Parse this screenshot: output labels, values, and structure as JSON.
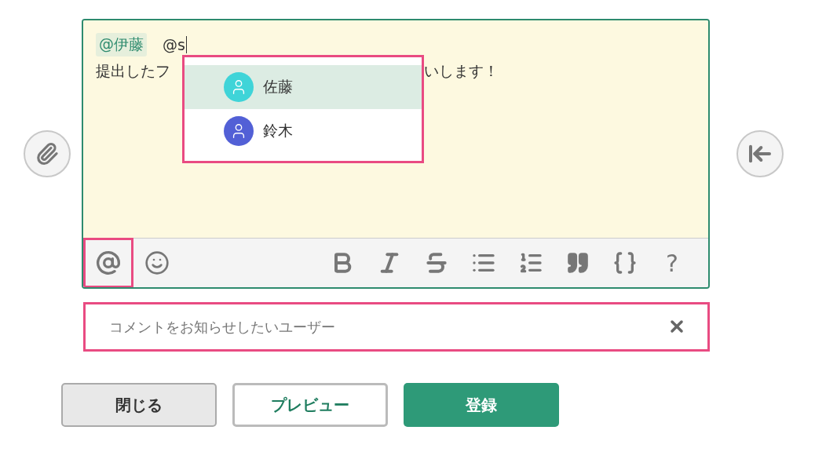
{
  "editor": {
    "mention": "@伊藤",
    "typed": "@s",
    "line_start": "提出したフ",
    "line_end": "いします！"
  },
  "suggestions": [
    {
      "name": "佐藤",
      "selected": true,
      "color": "#3fd4d8"
    },
    {
      "name": "鈴木",
      "selected": false,
      "color": "#5260d6"
    }
  ],
  "toolbar": {
    "help": "?"
  },
  "notify_field": {
    "placeholder": "コメントをお知らせしたいユーザー"
  },
  "buttons": [
    {
      "label": "閉じる",
      "kind": "secondary"
    },
    {
      "label": "プレビュー",
      "kind": "outline"
    },
    {
      "label": "登録",
      "kind": "primary"
    }
  ]
}
